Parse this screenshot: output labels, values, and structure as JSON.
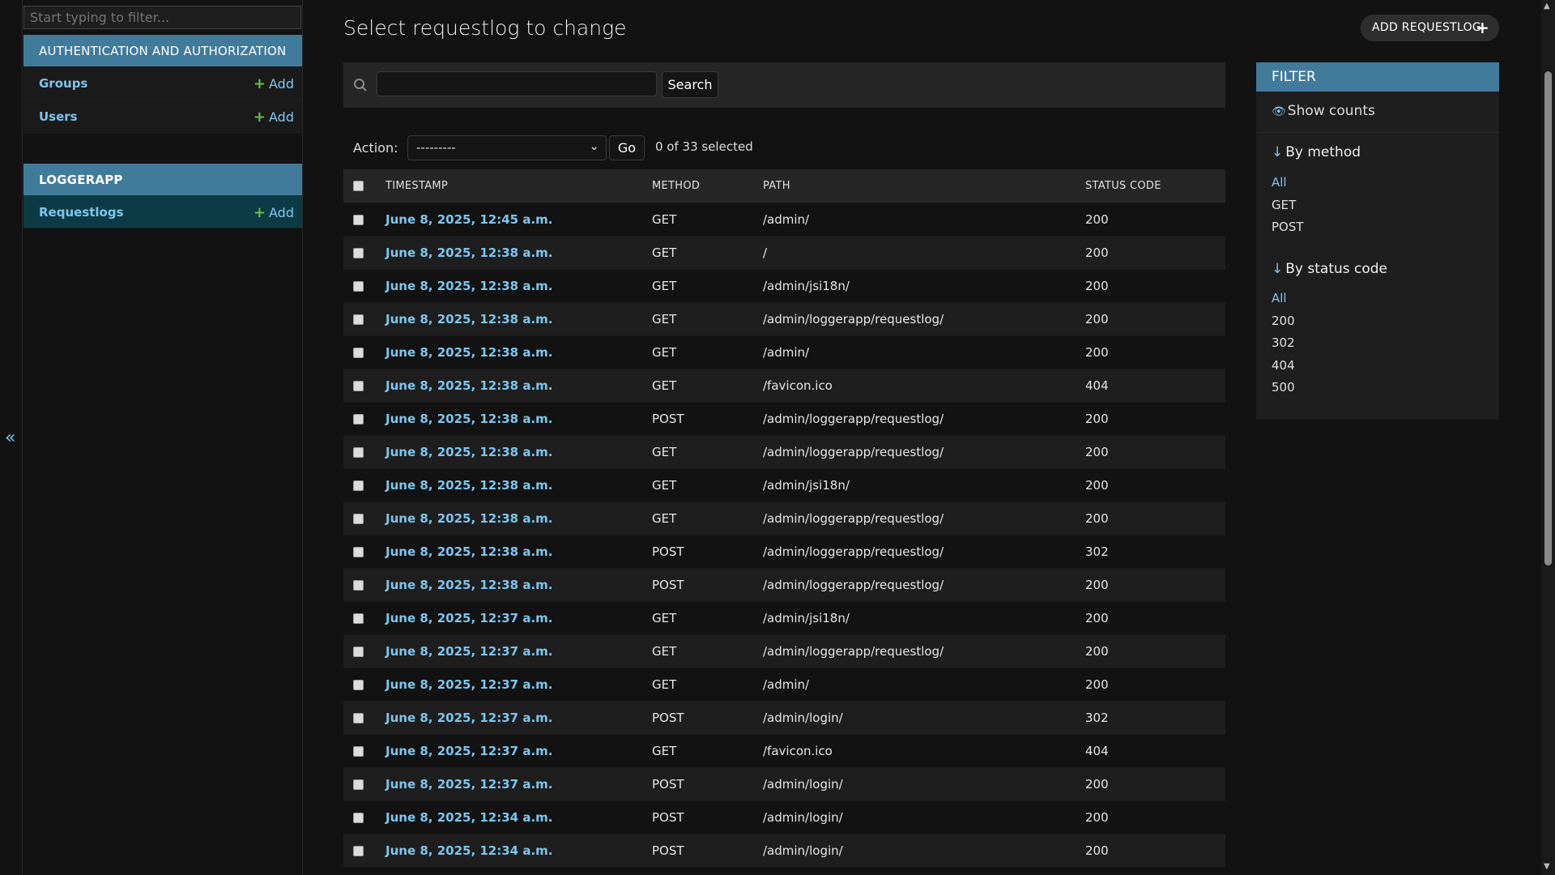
{
  "sidebar": {
    "filter_placeholder": "Start typing to filter...",
    "collapse_glyph": "«",
    "apps": [
      {
        "caption": "AUTHENTICATION AND AUTHORIZATION",
        "models": [
          {
            "name": "Groups",
            "add_label": "Add"
          },
          {
            "name": "Users",
            "add_label": "Add"
          }
        ]
      },
      {
        "caption": "LOGGERAPP",
        "models": [
          {
            "name": "Requestlogs",
            "add_label": "Add"
          }
        ]
      }
    ]
  },
  "main": {
    "title": "Select requestlog to change",
    "add_button_label": "ADD REQUESTLOG",
    "search_button_label": "Search",
    "action_label": "Action:",
    "action_selected": "---------",
    "go_label": "Go",
    "selected_count": "0 of 33 selected"
  },
  "table": {
    "columns": [
      "TIMESTAMP",
      "METHOD",
      "PATH",
      "STATUS CODE"
    ],
    "rows": [
      {
        "timestamp": "June 8, 2025, 12:45 a.m.",
        "method": "GET",
        "path": "/admin/",
        "status": "200"
      },
      {
        "timestamp": "June 8, 2025, 12:38 a.m.",
        "method": "GET",
        "path": "/",
        "status": "200"
      },
      {
        "timestamp": "June 8, 2025, 12:38 a.m.",
        "method": "GET",
        "path": "/admin/jsi18n/",
        "status": "200"
      },
      {
        "timestamp": "June 8, 2025, 12:38 a.m.",
        "method": "GET",
        "path": "/admin/loggerapp/requestlog/",
        "status": "200"
      },
      {
        "timestamp": "June 8, 2025, 12:38 a.m.",
        "method": "GET",
        "path": "/admin/",
        "status": "200"
      },
      {
        "timestamp": "June 8, 2025, 12:38 a.m.",
        "method": "GET",
        "path": "/favicon.ico",
        "status": "404"
      },
      {
        "timestamp": "June 8, 2025, 12:38 a.m.",
        "method": "POST",
        "path": "/admin/loggerapp/requestlog/",
        "status": "200"
      },
      {
        "timestamp": "June 8, 2025, 12:38 a.m.",
        "method": "GET",
        "path": "/admin/loggerapp/requestlog/",
        "status": "200"
      },
      {
        "timestamp": "June 8, 2025, 12:38 a.m.",
        "method": "GET",
        "path": "/admin/jsi18n/",
        "status": "200"
      },
      {
        "timestamp": "June 8, 2025, 12:38 a.m.",
        "method": "GET",
        "path": "/admin/loggerapp/requestlog/",
        "status": "200"
      },
      {
        "timestamp": "June 8, 2025, 12:38 a.m.",
        "method": "POST",
        "path": "/admin/loggerapp/requestlog/",
        "status": "302"
      },
      {
        "timestamp": "June 8, 2025, 12:38 a.m.",
        "method": "POST",
        "path": "/admin/loggerapp/requestlog/",
        "status": "200"
      },
      {
        "timestamp": "June 8, 2025, 12:37 a.m.",
        "method": "GET",
        "path": "/admin/jsi18n/",
        "status": "200"
      },
      {
        "timestamp": "June 8, 2025, 12:37 a.m.",
        "method": "GET",
        "path": "/admin/loggerapp/requestlog/",
        "status": "200"
      },
      {
        "timestamp": "June 8, 2025, 12:37 a.m.",
        "method": "GET",
        "path": "/admin/",
        "status": "200"
      },
      {
        "timestamp": "June 8, 2025, 12:37 a.m.",
        "method": "POST",
        "path": "/admin/login/",
        "status": "302"
      },
      {
        "timestamp": "June 8, 2025, 12:37 a.m.",
        "method": "GET",
        "path": "/favicon.ico",
        "status": "404"
      },
      {
        "timestamp": "June 8, 2025, 12:37 a.m.",
        "method": "POST",
        "path": "/admin/login/",
        "status": "200"
      },
      {
        "timestamp": "June 8, 2025, 12:34 a.m.",
        "method": "POST",
        "path": "/admin/login/",
        "status": "200"
      },
      {
        "timestamp": "June 8, 2025, 12:34 a.m.",
        "method": "POST",
        "path": "/admin/login/",
        "status": "200"
      }
    ]
  },
  "filter": {
    "title": "FILTER",
    "show_counts": "Show counts",
    "by_method": {
      "heading": "By method",
      "options": [
        "All",
        "GET",
        "POST"
      ],
      "selected": "All"
    },
    "by_status": {
      "heading": "By status code",
      "options": [
        "All",
        "200",
        "302",
        "404",
        "500"
      ],
      "selected": "All"
    }
  },
  "colors": {
    "accent": "#417b9c",
    "link": "#7cc6ee",
    "add_plus": "#6bbd4d",
    "background": "#121212"
  }
}
